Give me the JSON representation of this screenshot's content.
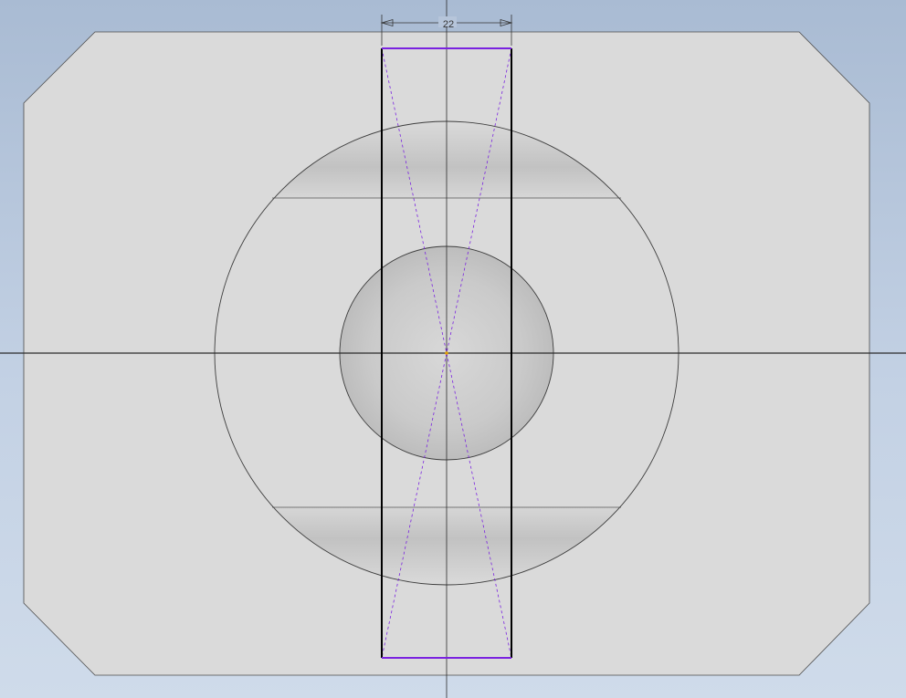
{
  "viewport": {
    "background_top": "#a9bbd3",
    "background_bottom": "#cfdbea"
  },
  "part": {
    "face_color": "#dadada",
    "edge_color": "#4a4a4a",
    "shading_color": "#b9b9b9"
  },
  "sketch": {
    "rectangle_color": "#000000",
    "constraint_color": "#7a22e0",
    "axis_color": "#2b2b2b"
  },
  "dimension": {
    "label": "22",
    "color": "#333333"
  }
}
